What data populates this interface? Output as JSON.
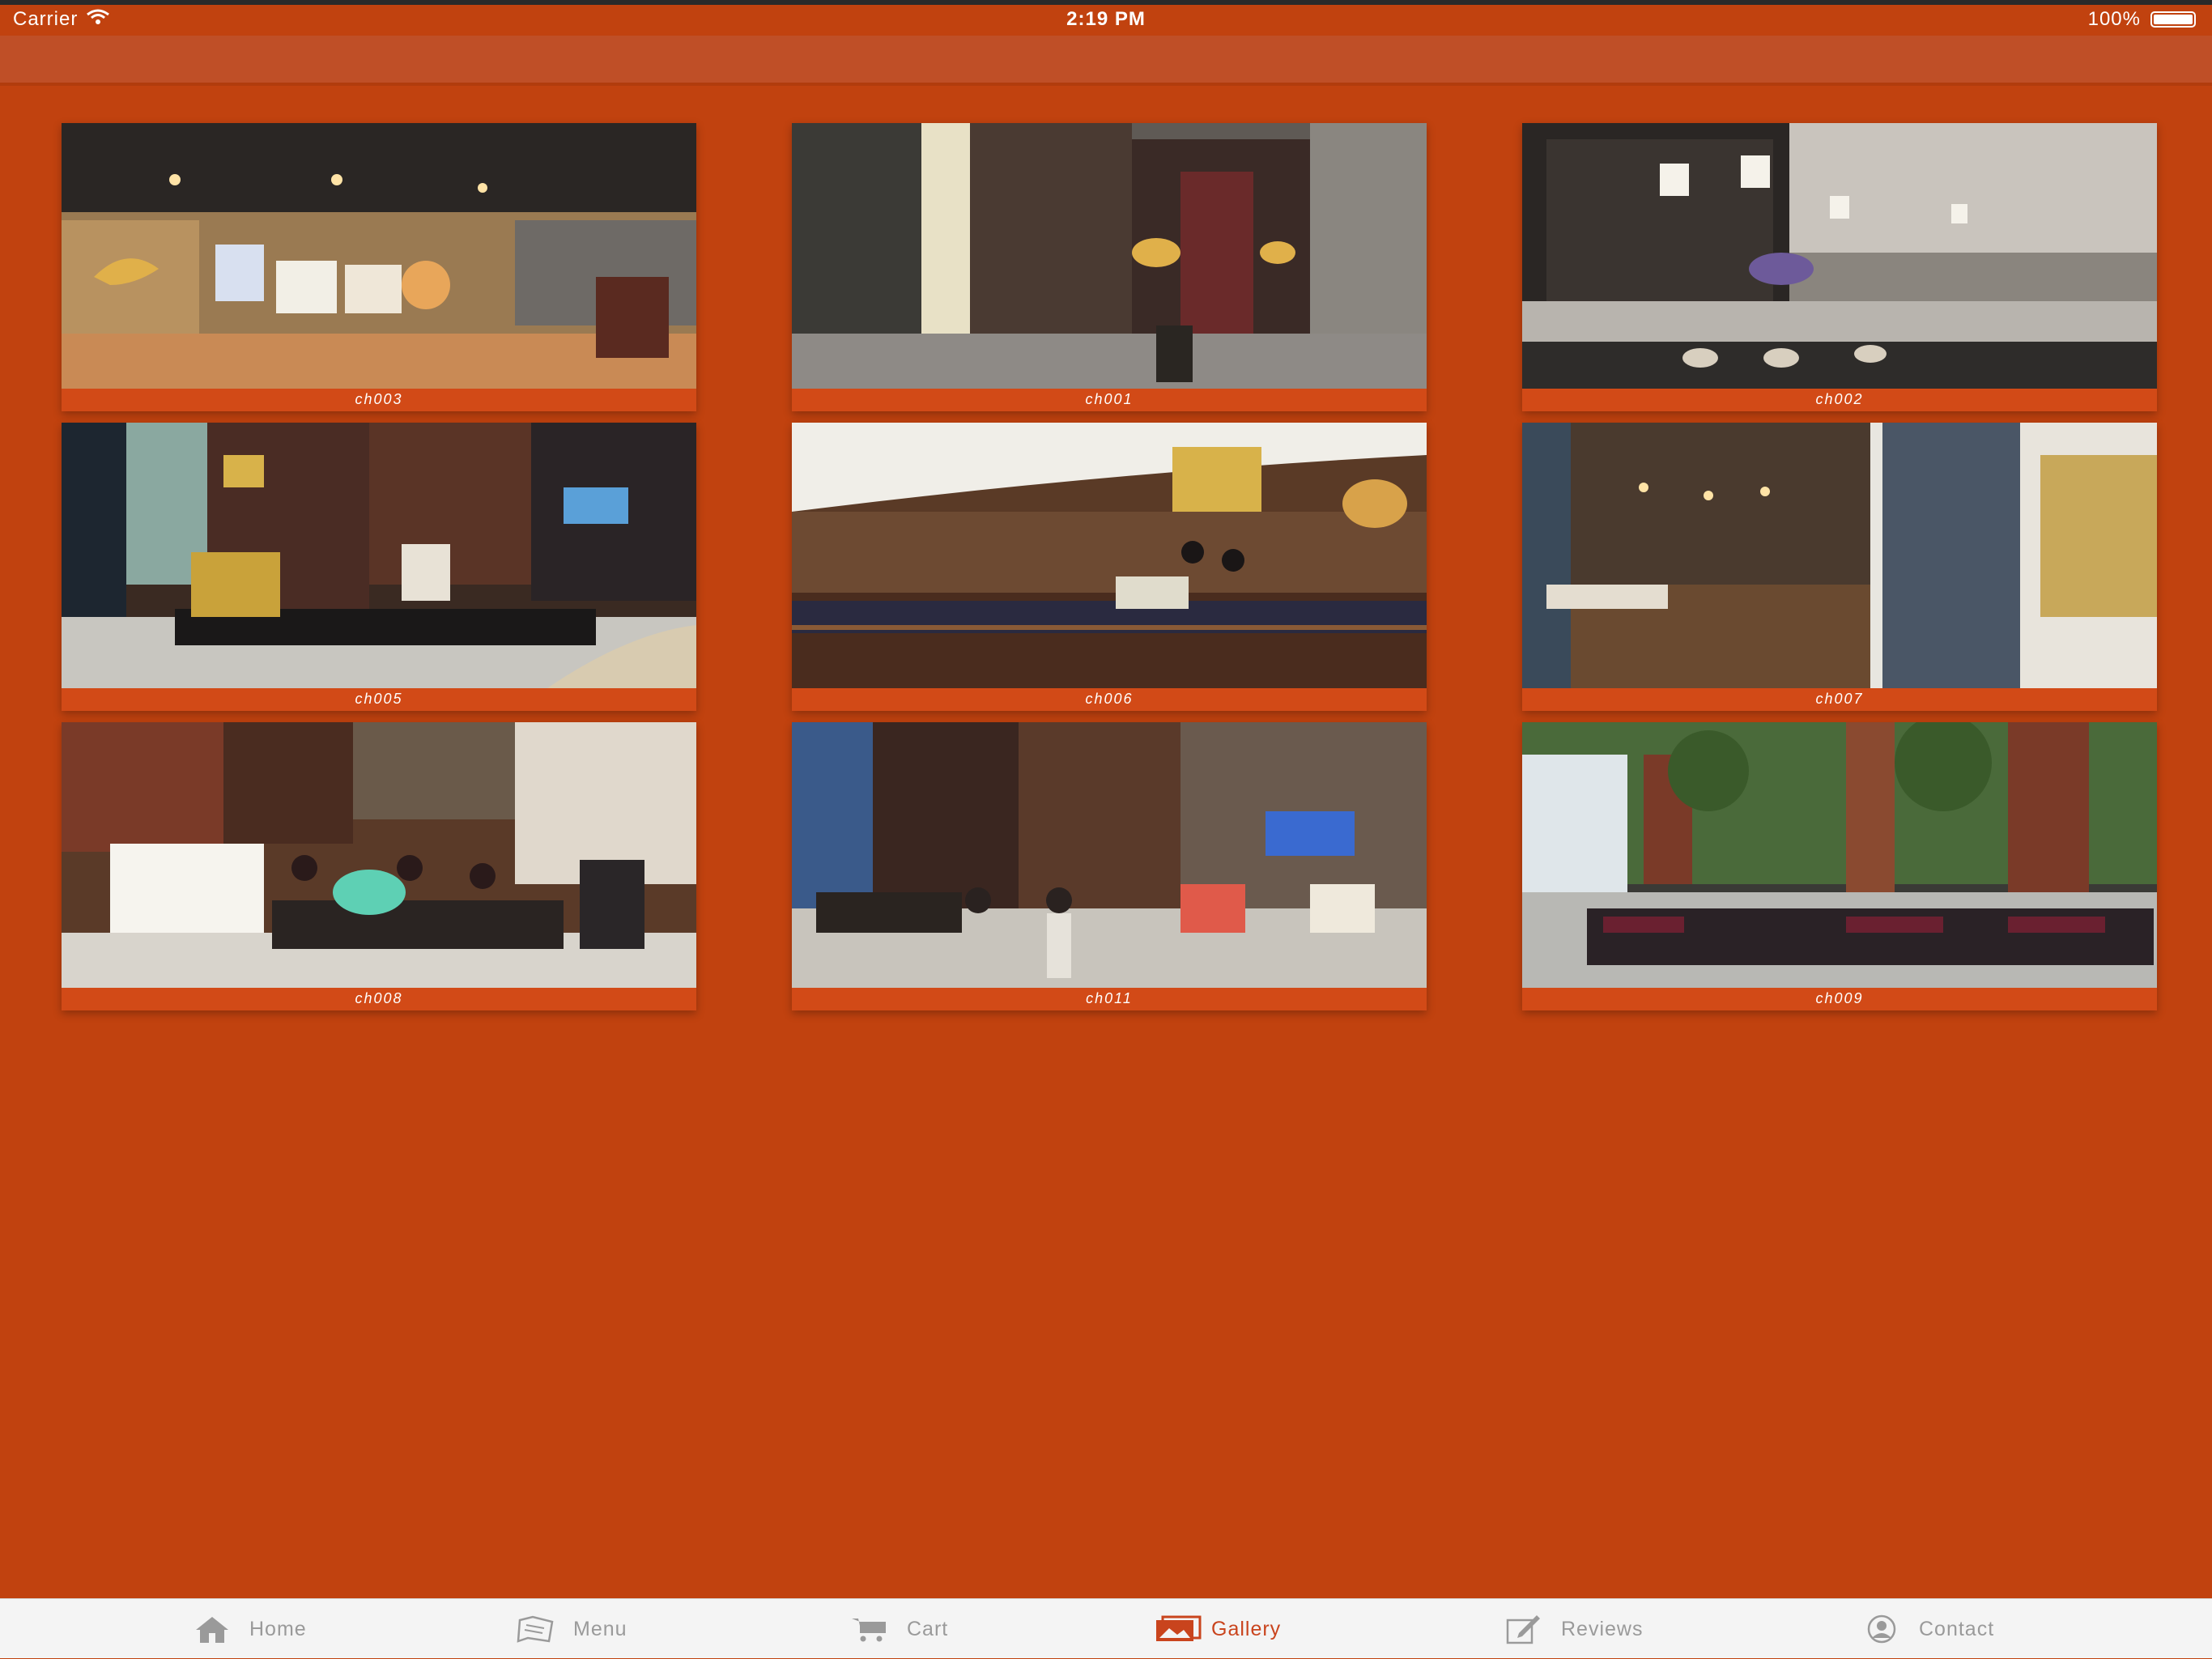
{
  "status_bar": {
    "carrier": "Carrier",
    "time": "2:19 PM",
    "battery": "100%",
    "battery_level": 1.0
  },
  "gallery": {
    "items": [
      {
        "caption": "ch003"
      },
      {
        "caption": "ch001"
      },
      {
        "caption": "ch002"
      },
      {
        "caption": "ch005"
      },
      {
        "caption": "ch006"
      },
      {
        "caption": "ch007"
      },
      {
        "caption": "ch008"
      },
      {
        "caption": "ch011"
      },
      {
        "caption": "ch009"
      }
    ]
  },
  "tab_bar": {
    "active": "gallery",
    "active_color": "#c9441d",
    "items": [
      {
        "label": "Home",
        "icon": "home-icon"
      },
      {
        "label": "Menu",
        "icon": "menu-book-icon"
      },
      {
        "label": "Cart",
        "icon": "cart-icon"
      },
      {
        "label": "Gallery",
        "icon": "gallery-icon"
      },
      {
        "label": "Reviews",
        "icon": "edit-icon"
      },
      {
        "label": "Contact",
        "icon": "contact-icon"
      }
    ]
  },
  "colors": {
    "background": "#c1420f",
    "nav_bar": "#bf4f27",
    "tab_bar": "#f4f4f4",
    "tab_inactive": "#9a9a9a"
  }
}
